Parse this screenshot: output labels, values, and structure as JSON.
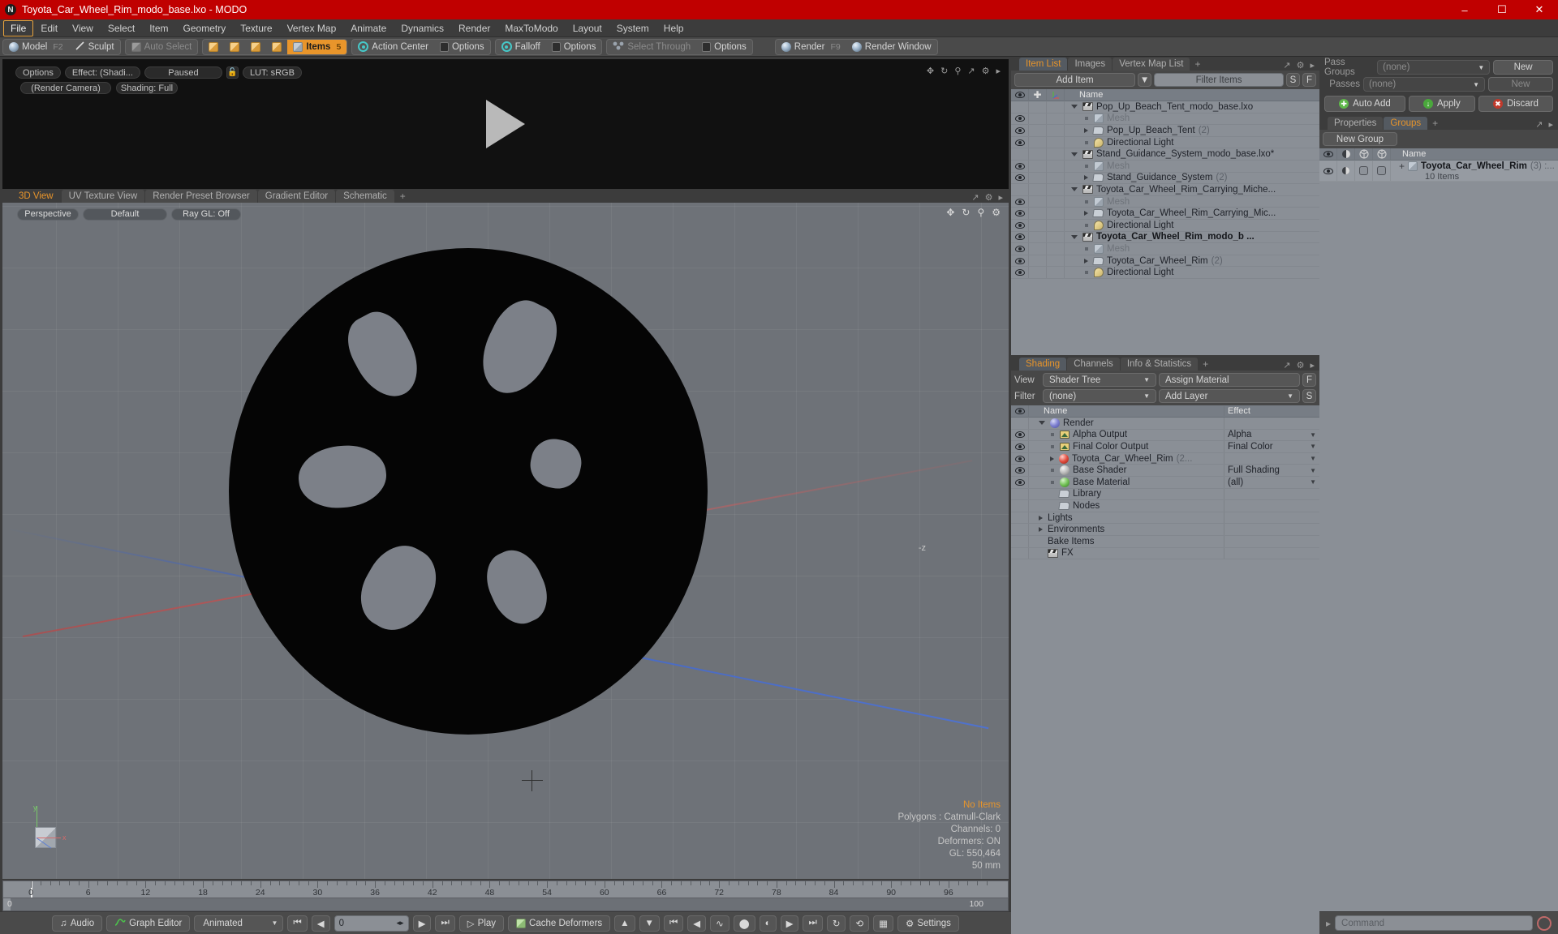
{
  "window": {
    "title": "Toyota_Car_Wheel_Rim_modo_base.lxo - MODO",
    "minimize": "–",
    "maximize": "☐",
    "close": "✕"
  },
  "menu": [
    "File",
    "Edit",
    "View",
    "Select",
    "Item",
    "Geometry",
    "Texture",
    "Vertex Map",
    "Animate",
    "Dynamics",
    "Render",
    "MaxToModo",
    "Layout",
    "System",
    "Help"
  ],
  "toolbar": {
    "model": "Model",
    "model_key": "F2",
    "sculpt": "Sculpt",
    "auto_select": "Auto Select",
    "items": "Items",
    "items_key": "5",
    "action_center": "Action Center",
    "options1": "Options",
    "falloff": "Falloff",
    "options2": "Options",
    "select_through": "Select Through",
    "options3": "Options",
    "render": "Render",
    "render_key": "F9",
    "render_window": "Render Window"
  },
  "preview": {
    "options": "Options",
    "effect": "Effect: (Shadi...",
    "paused": "Paused",
    "lut": "LUT: sRGB",
    "camera": "(Render Camera)",
    "shading": "Shading: Full"
  },
  "viewport_tabs": {
    "tabs": [
      "3D View",
      "UV Texture View",
      "Render Preset Browser",
      "Gradient Editor",
      "Schematic"
    ],
    "selected": "3D View",
    "plus": "+"
  },
  "viewport": {
    "perspective": "Perspective",
    "default": "Default",
    "raygl": "Ray GL: Off",
    "z_label": "-z",
    "stats": {
      "no_items": "No Items",
      "polygons": "Polygons : Catmull-Clark",
      "channels": "Channels: 0",
      "deformers": "Deformers: ON",
      "gl": "GL: 550,464",
      "scale": "50 mm"
    },
    "gizmo": {
      "x": "x",
      "y": "y",
      "z": "z"
    }
  },
  "timeline": {
    "ticks": [
      0,
      6,
      12,
      18,
      24,
      30,
      36,
      42,
      48,
      54,
      60,
      66,
      72,
      78,
      84,
      90,
      96
    ],
    "range_start": "0",
    "range_end": "100",
    "cursor_frame": 0
  },
  "playbar": {
    "audio": "Audio",
    "graph_editor": "Graph Editor",
    "mode": "Animated",
    "frame_value": "0",
    "play": "Play",
    "cache_deformers": "Cache Deformers",
    "settings": "Settings"
  },
  "item_list": {
    "tabs": [
      "Item List",
      "Images",
      "Vertex Map List"
    ],
    "selected": "Item List",
    "plus": "+",
    "add_item": "Add Item",
    "filter_items": "Filter Items",
    "btn_s": "S",
    "btn_f": "F",
    "col_name": "Name",
    "rows": [
      {
        "indent": 0,
        "icon": "slate",
        "label": "Pop_Up_Beach_Tent_modo_base.lxo",
        "count": "",
        "eye": false,
        "toggle": "down",
        "bold": false,
        "muted": false
      },
      {
        "indent": 1,
        "icon": "cube",
        "label": "Mesh",
        "count": "",
        "eye": true,
        "toggle": "dot",
        "bold": false,
        "muted": true
      },
      {
        "indent": 1,
        "icon": "folder",
        "label": "Pop_Up_Beach_Tent",
        "count": "(2)",
        "eye": true,
        "toggle": "right",
        "bold": false,
        "muted": false
      },
      {
        "indent": 1,
        "icon": "lamp",
        "label": "Directional Light",
        "count": "",
        "eye": true,
        "toggle": "dot",
        "bold": false,
        "muted": false
      },
      {
        "indent": 0,
        "icon": "slate",
        "label": "Stand_Guidance_System_modo_base.lxo*",
        "count": "",
        "eye": false,
        "toggle": "down",
        "bold": false,
        "muted": false
      },
      {
        "indent": 1,
        "icon": "cube",
        "label": "Mesh",
        "count": "",
        "eye": true,
        "toggle": "dot",
        "bold": false,
        "muted": true
      },
      {
        "indent": 1,
        "icon": "folder",
        "label": "Stand_Guidance_System",
        "count": "(2)",
        "eye": true,
        "toggle": "right",
        "bold": false,
        "muted": false
      },
      {
        "indent": 0,
        "icon": "slate",
        "label": "Toyota_Car_Wheel_Rim_Carrying_Miche...",
        "count": "",
        "eye": false,
        "toggle": "down",
        "bold": false,
        "muted": false
      },
      {
        "indent": 1,
        "icon": "cube",
        "label": "Mesh",
        "count": "",
        "eye": true,
        "toggle": "dot",
        "bold": false,
        "muted": true
      },
      {
        "indent": 1,
        "icon": "folder",
        "label": "Toyota_Car_Wheel_Rim_Carrying_Mic...",
        "count": "",
        "eye": true,
        "toggle": "right",
        "bold": false,
        "muted": false
      },
      {
        "indent": 1,
        "icon": "lamp",
        "label": "Directional Light",
        "count": "",
        "eye": true,
        "toggle": "dot",
        "bold": false,
        "muted": false
      },
      {
        "indent": 0,
        "icon": "slate",
        "label": "Toyota_Car_Wheel_Rim_modo_b ...",
        "count": "",
        "eye": true,
        "toggle": "down",
        "bold": true,
        "muted": false
      },
      {
        "indent": 1,
        "icon": "cube",
        "label": "Mesh",
        "count": "",
        "eye": true,
        "toggle": "dot",
        "bold": false,
        "muted": true
      },
      {
        "indent": 1,
        "icon": "folder",
        "label": "Toyota_Car_Wheel_Rim",
        "count": "(2)",
        "eye": true,
        "toggle": "right",
        "bold": false,
        "muted": false
      },
      {
        "indent": 1,
        "icon": "lamp",
        "label": "Directional Light",
        "count": "",
        "eye": true,
        "toggle": "dot",
        "bold": false,
        "muted": false
      }
    ]
  },
  "shading": {
    "tabs": [
      "Shading",
      "Channels",
      "Info & Statistics"
    ],
    "selected": "Shading",
    "plus": "+",
    "view_label": "View",
    "view_value": "Shader Tree",
    "assign_material": "Assign Material",
    "btn_f": "F",
    "filter_label": "Filter",
    "filter_value": "(none)",
    "add_layer": "Add Layer",
    "btn_s": "S",
    "col_name": "Name",
    "col_effect": "Effect",
    "rows": [
      {
        "indent": 0,
        "icon": "ball-purple",
        "label": "Render",
        "count": "",
        "effect": "",
        "eye": false,
        "toggle": "down"
      },
      {
        "indent": 1,
        "icon": "img",
        "label": "Alpha Output",
        "count": "",
        "effect": "Alpha",
        "eye": true,
        "toggle": "dot"
      },
      {
        "indent": 1,
        "icon": "img",
        "label": "Final Color Output",
        "count": "",
        "effect": "Final Color",
        "eye": true,
        "toggle": "dot"
      },
      {
        "indent": 1,
        "icon": "ball-red",
        "label": "Toyota_Car_Wheel_Rim",
        "count": "(2...",
        "effect": "",
        "eye": true,
        "toggle": "right"
      },
      {
        "indent": 1,
        "icon": "ball-gray",
        "label": "Base Shader",
        "count": "",
        "effect": "Full Shading",
        "eye": true,
        "toggle": "dot"
      },
      {
        "indent": 1,
        "icon": "ball-green",
        "label": "Base Material",
        "count": "",
        "effect": "(all)",
        "eye": true,
        "toggle": "dot"
      },
      {
        "indent": 1,
        "icon": "folder",
        "label": "Library",
        "count": "",
        "effect": "",
        "eye": false,
        "toggle": "none"
      },
      {
        "indent": 1,
        "icon": "folder",
        "label": "Nodes",
        "count": "",
        "effect": "",
        "eye": false,
        "toggle": "none"
      },
      {
        "indent": 0,
        "icon": "none",
        "label": "Lights",
        "count": "",
        "effect": "",
        "eye": false,
        "toggle": "right"
      },
      {
        "indent": 0,
        "icon": "none",
        "label": "Environments",
        "count": "",
        "effect": "",
        "eye": false,
        "toggle": "right"
      },
      {
        "indent": 0,
        "icon": "none",
        "label": "Bake Items",
        "count": "",
        "effect": "",
        "eye": false,
        "toggle": "none"
      },
      {
        "indent": 0,
        "icon": "slate",
        "label": "FX",
        "count": "",
        "effect": "",
        "eye": false,
        "toggle": "none"
      }
    ]
  },
  "passes": {
    "pass_groups_label": "Pass Groups",
    "pass_groups_value": "(none)",
    "pass_groups_new": "New",
    "passes_label": "Passes",
    "passes_value": "(none)",
    "passes_new": "New",
    "auto_add": "Auto Add",
    "apply": "Apply",
    "discard": "Discard"
  },
  "groups": {
    "tabs": [
      "Properties",
      "Groups"
    ],
    "selected": "Groups",
    "plus": "+",
    "new_group": "New Group",
    "col_name": "Name",
    "rows": [
      {
        "label": "Toyota_Car_Wheel_Rim",
        "count": "(3) :...",
        "sub": "10 Items"
      }
    ]
  },
  "command": {
    "placeholder": "Command"
  },
  "colors": {
    "title_bar": "#c00000",
    "accent": "#e8952b",
    "panel_bg": "#3c3c3c",
    "tree_bg": "#8a8f96",
    "viewport_bg": "#6e7278"
  }
}
